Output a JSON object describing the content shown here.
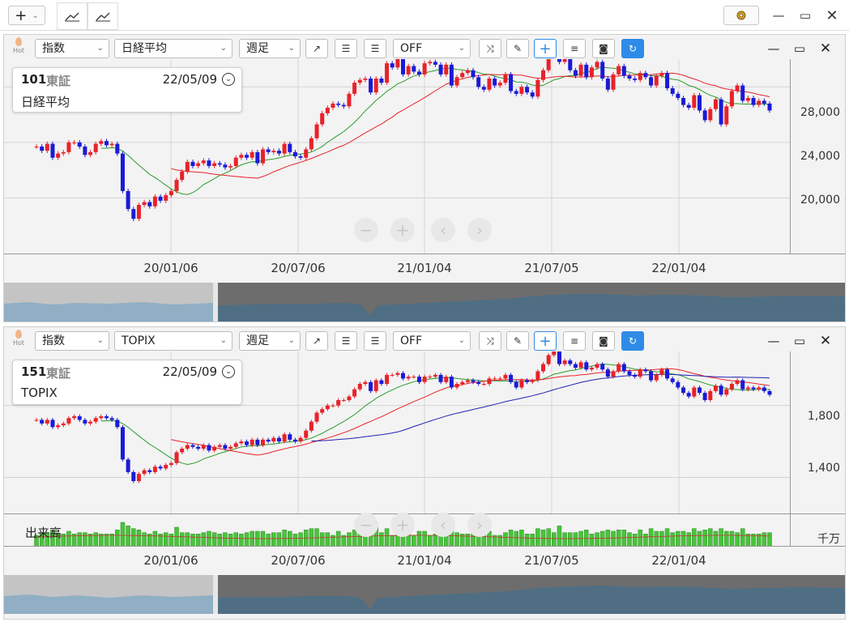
{
  "topbar": {
    "add_label": "+",
    "add_chev": "⌄"
  },
  "chart1": {
    "code": "101",
    "market": "東証",
    "date": "22/05/09",
    "name": "日経平均",
    "sel_type": "指数",
    "sel_name": "日経平均",
    "sel_period": "週足",
    "sel_off": "OFF",
    "hot_label": "Hot",
    "y_ticks": [
      "28,000",
      "24,000",
      "20,000"
    ],
    "x_ticks": [
      "20/01/06",
      "20/07/06",
      "21/01/04",
      "21/07/05",
      "22/01/04"
    ]
  },
  "chart2": {
    "code": "151",
    "market": "東証",
    "date": "22/05/09",
    "name": "TOPIX",
    "sel_type": "指数",
    "sel_name": "TOPIX",
    "sel_period": "週足",
    "sel_off": "OFF",
    "hot_label": "Hot",
    "y_ticks": [
      "1,800",
      "1,400"
    ],
    "volume_label": "出来高",
    "volume_unit": "千万",
    "x_ticks": [
      "20/01/06",
      "20/07/06",
      "21/01/04",
      "21/07/05",
      "22/01/04"
    ]
  },
  "colors": {
    "up": "#e8222a",
    "down": "#1a1ad6",
    "ma_short": "#2a9d2a",
    "ma_long": "#e8222a",
    "ma_blue": "#2222b0",
    "accent": "#2f8be8",
    "volume": "#49c43b"
  },
  "chart_data": [
    {
      "type": "candlestick",
      "title": "日経平均",
      "series": [
        {
          "name": "日経平均",
          "close": [
            23700,
            23400,
            23900,
            22900,
            23200,
            23300,
            24000,
            24000,
            23700,
            23100,
            23300,
            23900,
            24100,
            23800,
            23900,
            23200,
            20500,
            19200,
            18500,
            19500,
            19700,
            19400,
            20100,
            19800,
            20200,
            20500,
            21300,
            21900,
            22600,
            22300,
            22500,
            22700,
            22300,
            22500,
            22400,
            22200,
            22300,
            22900,
            23100,
            22900,
            23300,
            22500,
            23500,
            23300,
            23400,
            23200,
            23900,
            23300,
            23000,
            22900,
            23500,
            24300,
            25300,
            26100,
            26500,
            26800,
            26700,
            26600,
            27500,
            28300,
            28500,
            28600,
            27600,
            28600,
            28300,
            29700,
            29400,
            30200,
            28900,
            29500,
            29100,
            28900,
            29700,
            29800,
            29600,
            28900,
            29600,
            28100,
            28700,
            29000,
            29200,
            28700,
            28000,
            27800,
            28600,
            28100,
            28300,
            28900,
            27700,
            27500,
            28000,
            27600,
            27300,
            28500,
            29200,
            30400,
            30500,
            29800,
            30000,
            29200,
            28800,
            29600,
            28700,
            29400,
            29800,
            28600,
            27800,
            28900,
            29500,
            28800,
            28600,
            28500,
            29000,
            28700,
            28100,
            28800,
            29000,
            27900,
            27500,
            27200,
            26700,
            26500,
            27400,
            26300,
            25600,
            26400,
            27100,
            25300,
            26600,
            27700,
            28100,
            27000,
            27200,
            26700,
            27000,
            26800,
            26300
          ]
        }
      ],
      "ylim": [
        16000,
        30000
      ]
    },
    {
      "type": "candlestick",
      "title": "TOPIX",
      "series": [
        {
          "name": "TOPIX",
          "close": [
            1720,
            1700,
            1720,
            1680,
            1690,
            1700,
            1730,
            1740,
            1720,
            1700,
            1710,
            1730,
            1740,
            1730,
            1720,
            1680,
            1500,
            1430,
            1380,
            1420,
            1440,
            1430,
            1460,
            1450,
            1470,
            1480,
            1540,
            1560,
            1580,
            1570,
            1560,
            1580,
            1550,
            1570,
            1580,
            1560,
            1570,
            1590,
            1600,
            1580,
            1610,
            1580,
            1610,
            1600,
            1620,
            1600,
            1640,
            1610,
            1600,
            1620,
            1660,
            1710,
            1760,
            1780,
            1800,
            1800,
            1830,
            1830,
            1850,
            1890,
            1920,
            1930,
            1880,
            1940,
            1920,
            1970,
            1970,
            1980,
            1950,
            1960,
            1960,
            1930,
            1960,
            1960,
            1970,
            1930,
            1960,
            1900,
            1920,
            1930,
            1940,
            1930,
            1920,
            1920,
            1950,
            1950,
            1950,
            1970,
            1930,
            1900,
            1940,
            1930,
            1940,
            1990,
            2030,
            2080,
            2100,
            2030,
            2050,
            2030,
            2010,
            2040,
            2000,
            2010,
            2030,
            2000,
            1960,
            1990,
            2030,
            1990,
            1970,
            1960,
            2000,
            1990,
            1940,
            1970,
            2000,
            1950,
            1930,
            1900,
            1870,
            1850,
            1900,
            1870,
            1830,
            1880,
            1910,
            1860,
            1890,
            1920,
            1940,
            1890,
            1900,
            1890,
            1900,
            1880,
            1860
          ]
        }
      ],
      "ylim": [
        1200,
        2100
      ]
    }
  ]
}
